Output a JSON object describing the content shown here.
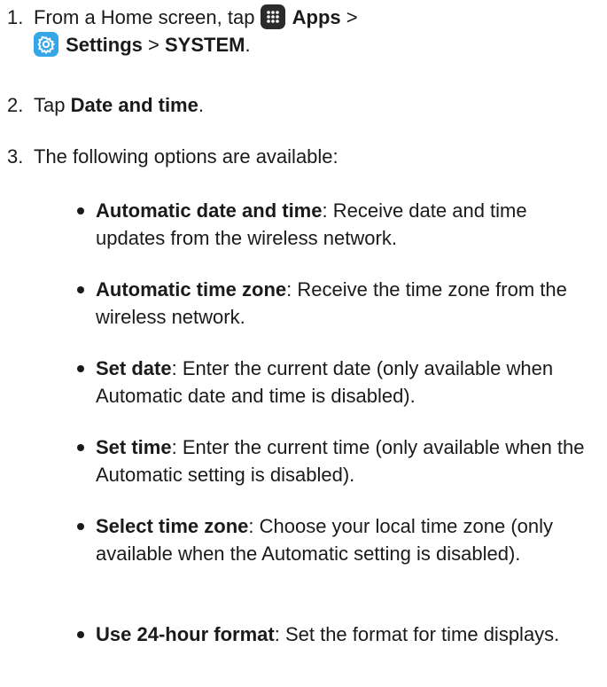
{
  "steps": [
    {
      "num": "1.",
      "pre": "From a Home screen, tap ",
      "apps_icon": "apps-grid-icon",
      "apps_label": "Apps",
      "sep1": " >",
      "settings_icon": "settings-gear-icon",
      "settings_label": "Settings",
      "sep2": " > ",
      "system_label": "SYSTEM",
      "end": "."
    },
    {
      "num": "2.",
      "pre": "Tap ",
      "bold": "Date and time",
      "end": "."
    },
    {
      "num": "3.",
      "text": "The following options are available:"
    }
  ],
  "options": [
    {
      "title": "Automatic date and time",
      "desc": ": Receive date and time updates from the wireless network."
    },
    {
      "title": "Automatic time zone",
      "desc": ": Receive the time zone from the wireless network."
    },
    {
      "title": "Set date",
      "desc": ": Enter the current date (only available when Automatic date and time is disabled)."
    },
    {
      "title": "Set time",
      "desc": ": Enter the current time (only available when the Automatic setting is disabled)."
    },
    {
      "title": "Select time zone",
      "desc": ": Choose your local time zone (only available when the Automatic setting is disabled)."
    },
    {
      "title": "Use 24-hour format",
      "desc": ": Set the format for time displays."
    }
  ],
  "colors": {
    "apps_icon_bg": "#2b2b2b",
    "settings_icon_bg": "#35a6e6"
  }
}
